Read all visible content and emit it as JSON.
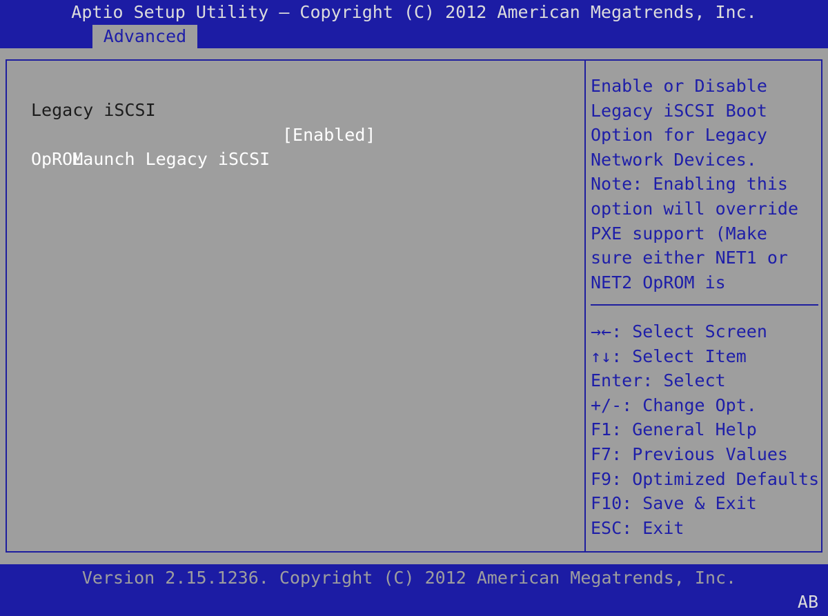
{
  "header": {
    "title": "Aptio Setup Utility – Copyright (C) 2012 American Megatrends, Inc.",
    "tabs": [
      {
        "label": "Advanced",
        "active": true
      }
    ]
  },
  "main": {
    "group_label": "Legacy iSCSI",
    "option": {
      "label_line1": "Launch Legacy iSCSI",
      "label_line2": "OpROM",
      "value": "[Enabled]"
    }
  },
  "help": {
    "lines": [
      "Enable or Disable",
      "Legacy iSCSI Boot",
      "Option for Legacy",
      "Network Devices.",
      "Note: Enabling this",
      "option will override",
      "PXE support (Make",
      "sure either NET1 or",
      "NET2 OpROM is"
    ]
  },
  "keys": [
    "→←: Select Screen",
    "↑↓: Select Item",
    "Enter: Select",
    "+/-: Change Opt.",
    "F1: General Help",
    "F7: Previous Values",
    "F9: Optimized Defaults",
    "F10: Save & Exit",
    "ESC: Exit"
  ],
  "footer": {
    "version": "Version 2.15.1236. Copyright (C) 2012 American Megatrends, Inc.",
    "indicator": "AB"
  },
  "colors": {
    "bar_blue": "#1c1ca4",
    "panel_gray": "#9e9e9e",
    "help_text_blue": "#1e1ea8",
    "selected_text": "#ffffff",
    "normal_text": "#1c1c1c"
  }
}
